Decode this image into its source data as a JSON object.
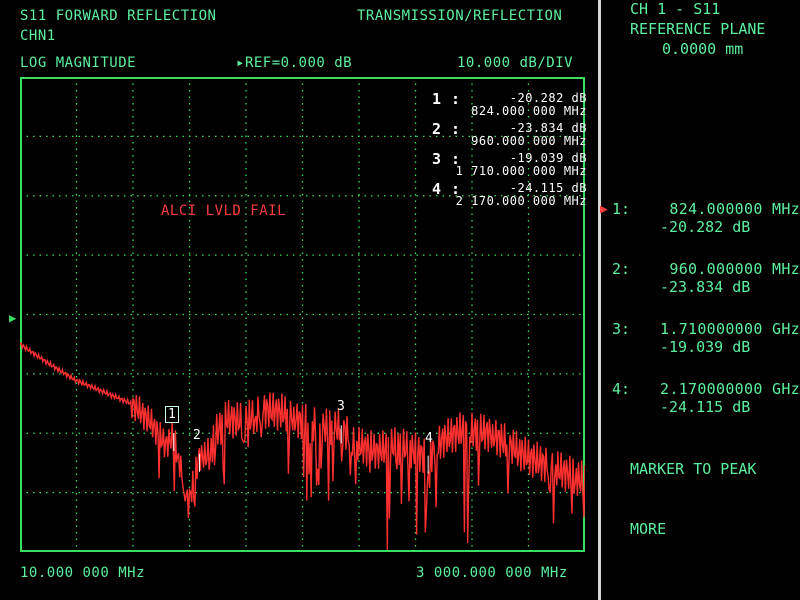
{
  "header": {
    "measurement": "S11 FORWARD REFLECTION",
    "channel": "CHN1",
    "mode": "TRANSMISSION/REFLECTION",
    "format": "LOG MAGNITUDE",
    "ref": "REF=0.000 dB",
    "scale": "10.000 dB/DIV"
  },
  "plot": {
    "warning": "ALCI LVLD FAIL",
    "start_freq": "10.000 000 MHz",
    "stop_freq": "3 000.000 000 MHz"
  },
  "markers": [
    {
      "num": "1 :",
      "db": "-20.282 dB",
      "freq": "824.000 000 MHz"
    },
    {
      "num": "2 :",
      "db": "-23.834 dB",
      "freq": "960.000 000 MHz"
    },
    {
      "num": "3 :",
      "db": "-19.039 dB",
      "freq": "1 710.000 000 MHz"
    },
    {
      "num": "4 :",
      "db": "-24.115 dB",
      "freq": "2 170.000 000 MHz"
    }
  ],
  "trace_marker_labels": [
    "1",
    "2",
    "3",
    "4"
  ],
  "softkeys": {
    "title1": "CH 1 - S11",
    "title2": "REFERENCE PLANE",
    "title3": "0.0000 mm",
    "items": [
      {
        "num": "1:",
        "freq": "824.000000 MHz",
        "db": "-20.282 dB"
      },
      {
        "num": "2:",
        "freq": "960.000000 MHz",
        "db": "-23.834 dB"
      },
      {
        "num": "3:",
        "freq": "1.710000000 GHz",
        "db": "-19.039 dB"
      },
      {
        "num": "4:",
        "freq": "2.170000000 GHz",
        "db": "-24.115 dB"
      }
    ],
    "marker_to_peak": "MARKER TO PEAK",
    "more": "MORE"
  },
  "colors": {
    "grid": "#38e060",
    "trace": "#ff3030",
    "text": "#5cf0a0"
  },
  "chart_data": {
    "type": "line",
    "x_range_mhz": [
      10,
      3000
    ],
    "y_ref_db": 0,
    "y_scale_db_per_div": 10,
    "series": [
      {
        "x": [
          10,
          150,
          300,
          450,
          600,
          700,
          780,
          824,
          900,
          960,
          1000,
          1050,
          1100,
          1200,
          1300,
          1400,
          1500,
          1600,
          1710,
          1800,
          1900,
          2000,
          2100,
          2170,
          2250,
          2350,
          2500,
          2600,
          2700,
          2850,
          3000
        ],
        "y": [
          -5,
          -8,
          -11,
          -13,
          -15,
          -18,
          -22,
          -20.3,
          -32,
          -23.8,
          -24,
          -20,
          -17.5,
          -18,
          -16,
          -16.5,
          -18,
          -19,
          -19,
          -22,
          -23,
          -22,
          -23,
          -24.1,
          -21,
          -19.5,
          -20,
          -22,
          -24,
          -26,
          -28
        ]
      }
    ]
  }
}
